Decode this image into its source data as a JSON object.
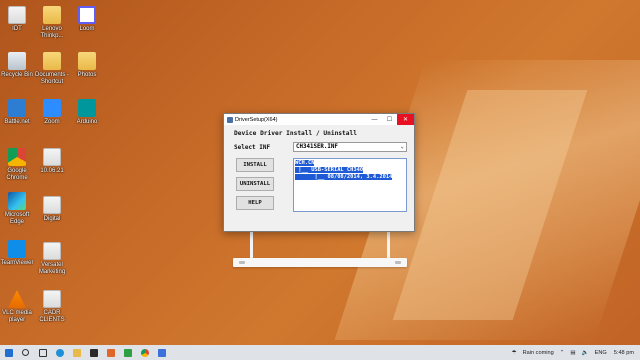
{
  "desktop": {
    "icons": [
      {
        "label": "IDT",
        "icon": "file-icon"
      },
      {
        "label": "Lenovo Thinkp...",
        "icon": "folder-icon"
      },
      {
        "label": "Loom",
        "icon": "loom-icon"
      },
      {
        "label": "Recycle Bin",
        "icon": "recycle-bin-icon"
      },
      {
        "label": "Documents - Shortcut",
        "icon": "folder-icon"
      },
      {
        "label": "Photos",
        "icon": "folder-icon"
      },
      {
        "label": "Battle.net",
        "icon": "battlenet-icon"
      },
      {
        "label": "Zoom",
        "icon": "zoom-icon"
      },
      {
        "label": "Arduino",
        "icon": "arduino-icon"
      },
      {
        "label": "Google Chrome",
        "icon": "chrome-icon"
      },
      {
        "label": "10.06.21",
        "icon": "file-icon"
      },
      {
        "label": "Microsoft Edge",
        "icon": "edge-icon"
      },
      {
        "label": "Digital",
        "icon": "file-icon"
      },
      {
        "label": "TeamViewer",
        "icon": "teamviewer-icon"
      },
      {
        "label": "Versatel Marketing",
        "icon": "file-icon"
      },
      {
        "label": "VLC media player",
        "icon": "vlc-icon"
      },
      {
        "label": "CADR CLIENTS",
        "icon": "file-icon"
      }
    ]
  },
  "dialog": {
    "title": "DriverSetup(X64)",
    "minimize": "—",
    "maximize": "☐",
    "close": "✕",
    "heading": "Device Driver Install / Uninstall",
    "select_label": "Select INF",
    "selected_inf": "CH341SER.INF",
    "buttons": {
      "install": "INSTALL",
      "uninstall": "UNINSTALL",
      "help": "HELP"
    },
    "tree": [
      "WCH.CN",
      " |__ USB-SERIAL CH340",
      "      |__ 08/08/2014, 3.4.2014"
    ]
  },
  "taskbar": {
    "weather": "Rain coming",
    "language": "ENG",
    "time": "5:48 pm"
  }
}
